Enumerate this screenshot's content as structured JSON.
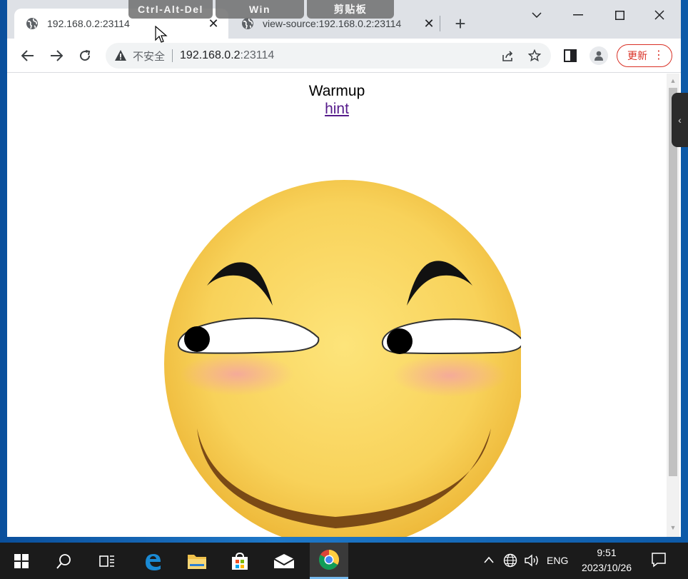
{
  "remote_bar": {
    "ctrl_alt_del": "Ctrl-Alt-Del",
    "win": "Win",
    "clipboard": "剪贴板"
  },
  "tabs": [
    {
      "title": "192.168.0.2:23114",
      "active": true,
      "icon": "globe-icon"
    },
    {
      "title": "view-source:192.168.0.2:23114",
      "active": false,
      "icon": "globe-icon"
    }
  ],
  "omnibox": {
    "security_label": "不安全",
    "host": "192.168.0.2",
    "port": ":23114"
  },
  "update_button": {
    "label": "更新"
  },
  "page": {
    "heading": "Warmup",
    "link": "hint"
  },
  "taskbar": {
    "language": "ENG",
    "time": "9:51",
    "date": "2023/10/26"
  },
  "colors": {
    "tabstrip": "#dee1e6",
    "update_red": "#d93025",
    "link_visited": "#551a8b",
    "taskbar": "#1b1b1b"
  }
}
